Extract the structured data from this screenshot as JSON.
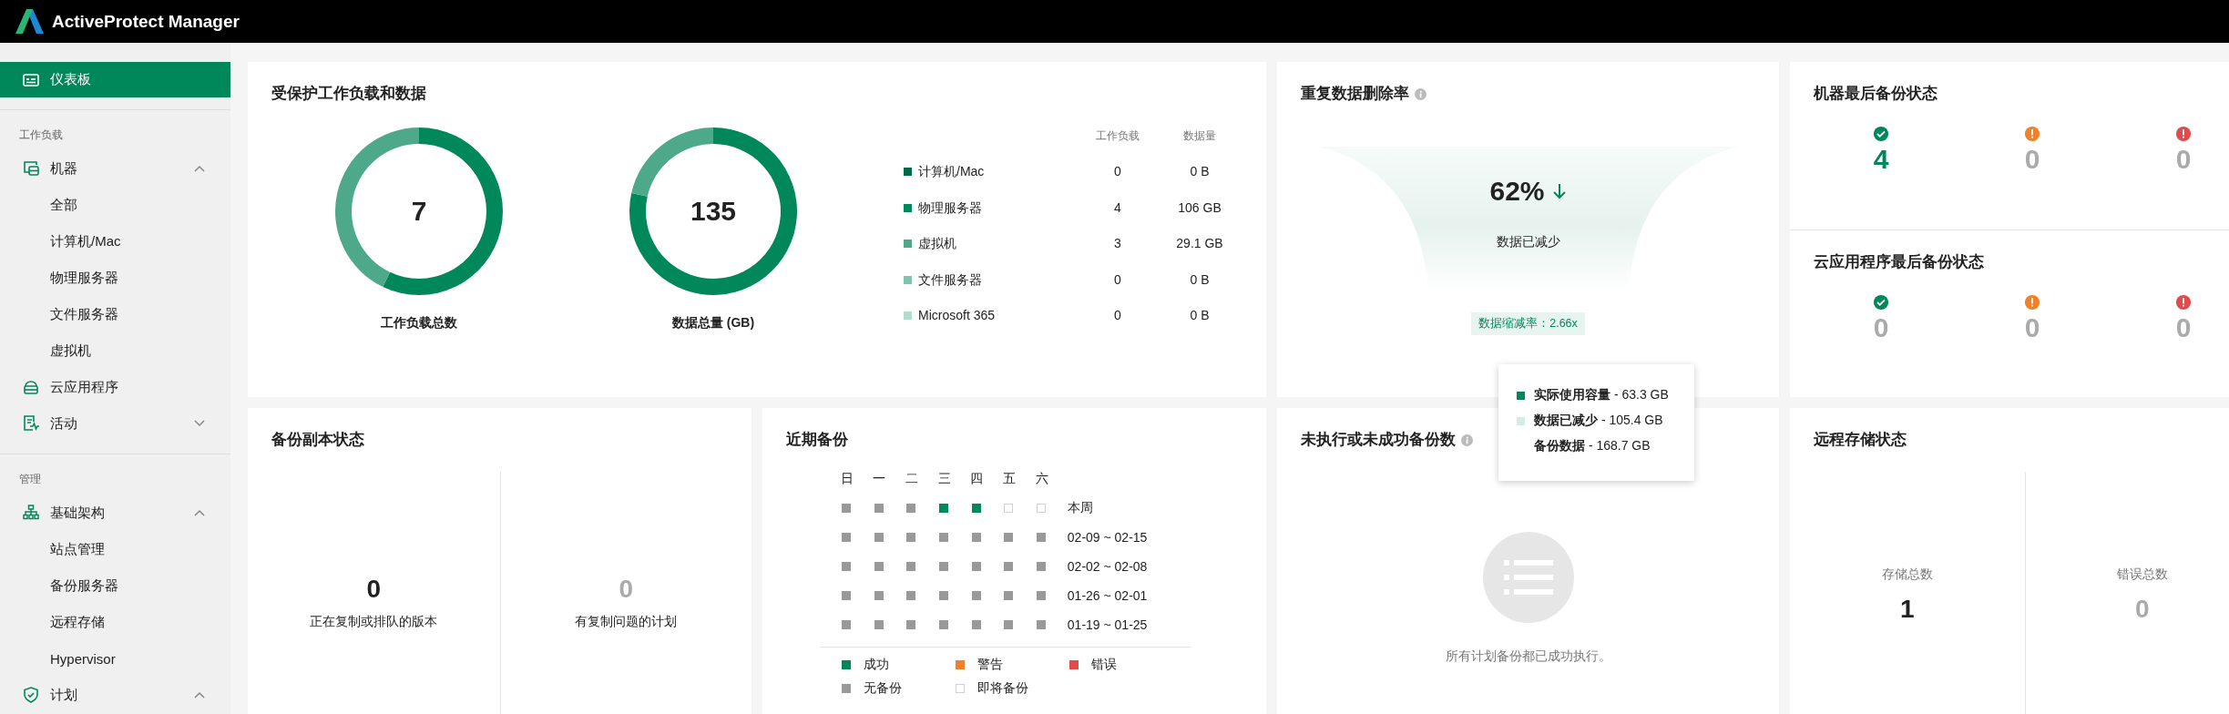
{
  "header": {
    "title": "ActiveProtect Manager"
  },
  "sidebar": {
    "top_item": {
      "label": "仪表板",
      "kind": "dashboard",
      "selected": true
    },
    "sections": [
      {
        "heading": "工作负载",
        "items": [
          {
            "label": "机器",
            "kind": "machine",
            "selected": false,
            "expanded": true,
            "children": [
              {
                "label": "全部",
                "selected": false
              },
              {
                "label": "计算机/Mac",
                "selected": false
              },
              {
                "label": "物理服务器",
                "selected": false
              },
              {
                "label": "文件服务器",
                "selected": false
              },
              {
                "label": "虚拟机",
                "selected": false
              }
            ]
          },
          {
            "label": "云应用程序",
            "kind": "cloud",
            "selected": false
          },
          {
            "label": "活动",
            "kind": "activity",
            "selected": false,
            "expanded": false
          }
        ]
      },
      {
        "heading": "管理",
        "items": [
          {
            "label": "基础架构",
            "kind": "network",
            "selected": false,
            "expanded": true,
            "children": [
              {
                "label": "站点管理",
                "selected": false
              },
              {
                "label": "备份服务器",
                "selected": false
              },
              {
                "label": "远程存储",
                "selected": false
              },
              {
                "label": "Hypervisor",
                "selected": false
              }
            ]
          },
          {
            "label": "计划",
            "kind": "shield",
            "selected": false,
            "expanded": true
          }
        ]
      }
    ]
  },
  "protected_workloads": {
    "title": "受保护工作负载和数据",
    "donuts": [
      {
        "value": "7",
        "caption": "工作负载总数",
        "chart_data": {
          "type": "donut",
          "values": [
            57.1,
            42.9
          ]
        }
      },
      {
        "value": "135",
        "caption": "数据总量 (GB)",
        "chart_data": {
          "type": "donut",
          "values": [
            78.5,
            21.5
          ]
        }
      }
    ],
    "legend": {
      "columns": [
        "工作负载",
        "数据量"
      ],
      "rows": [
        {
          "name": "计算机/Mac",
          "color": "#006b47",
          "workloads": "0",
          "data": "0 B"
        },
        {
          "name": "物理服务器",
          "color": "#00875a",
          "workloads": "4",
          "data": "106 GB"
        },
        {
          "name": "虚拟机",
          "color": "#4ea88a",
          "workloads": "3",
          "data": "29.1 GB"
        },
        {
          "name": "文件服务器",
          "color": "#80c4ac",
          "workloads": "0",
          "data": "0 B"
        },
        {
          "name": "Microsoft 365",
          "color": "#b3dccc",
          "workloads": "0",
          "data": "0 B"
        }
      ]
    }
  },
  "dedup": {
    "title": "重复数据删除率",
    "percent": "62%",
    "trend": {
      "kind": "down"
    },
    "caption": "数据已减少",
    "ratio_badge": "数据缩减率：2.66x"
  },
  "dedup_tooltip": {
    "rows": [
      {
        "text": "**实际使用容量** - 63.3 GB",
        "color": "#00875a"
      },
      {
        "text": "**数据已减少** - 105.4 GB",
        "color": "#d6ebe3"
      },
      {
        "text": "**备份数据** - 168.7 GB"
      }
    ]
  },
  "machine_backup_status": {
    "title": "机器最后备份状态",
    "items": [
      {
        "kind": "success",
        "count": "4",
        "highlighted": true
      },
      {
        "kind": "warning",
        "count": "0",
        "highlighted": false
      },
      {
        "kind": "error",
        "count": "0",
        "highlighted": false
      }
    ]
  },
  "cloud_backup_status": {
    "title": "云应用程序最后备份状态",
    "items": [
      {
        "kind": "success",
        "count": "0",
        "highlighted": false
      },
      {
        "kind": "warning",
        "count": "0",
        "highlighted": false
      },
      {
        "kind": "error",
        "count": "0",
        "highlighted": false
      }
    ]
  },
  "backup_copy_status": {
    "title": "备份副本状态",
    "stats": [
      {
        "value": "0",
        "label": "正在复制或排队的版本",
        "muted": false
      },
      {
        "value": "0",
        "label": "有复制问题的计划",
        "muted": true
      }
    ]
  },
  "recent_backups": {
    "title": "近期备份",
    "days": [
      "日",
      "一",
      "二",
      "三",
      "四",
      "五",
      "六"
    ],
    "weeks": [
      {
        "label": "本周",
        "cells": [
          {
            "kind": "none"
          },
          {
            "kind": "none"
          },
          {
            "kind": "none"
          },
          {
            "kind": "success"
          },
          {
            "kind": "success"
          },
          {
            "kind": "upcoming"
          },
          {
            "kind": "upcoming"
          }
        ]
      },
      {
        "label": "02-09 ~ 02-15",
        "cells": [
          {
            "kind": "none"
          },
          {
            "kind": "none"
          },
          {
            "kind": "none"
          },
          {
            "kind": "none"
          },
          {
            "kind": "none"
          },
          {
            "kind": "none"
          },
          {
            "kind": "none"
          }
        ]
      },
      {
        "label": "02-02 ~ 02-08",
        "cells": [
          {
            "kind": "none"
          },
          {
            "kind": "none"
          },
          {
            "kind": "none"
          },
          {
            "kind": "none"
          },
          {
            "kind": "none"
          },
          {
            "kind": "none"
          },
          {
            "kind": "none"
          }
        ]
      },
      {
        "label": "01-26 ~ 02-01",
        "cells": [
          {
            "kind": "none"
          },
          {
            "kind": "none"
          },
          {
            "kind": "none"
          },
          {
            "kind": "none"
          },
          {
            "kind": "none"
          },
          {
            "kind": "none"
          },
          {
            "kind": "none"
          }
        ]
      },
      {
        "label": "01-19 ~ 01-25",
        "cells": [
          {
            "kind": "none"
          },
          {
            "kind": "none"
          },
          {
            "kind": "none"
          },
          {
            "kind": "none"
          },
          {
            "kind": "none"
          },
          {
            "kind": "none"
          },
          {
            "kind": "none"
          }
        ]
      }
    ],
    "legend": [
      {
        "kind": "success",
        "label": "成功"
      },
      {
        "kind": "warning",
        "label": "警告"
      },
      {
        "kind": "error",
        "label": "错误"
      },
      {
        "kind": "none",
        "label": "无备份"
      },
      {
        "kind": "upcoming",
        "label": "即将备份"
      }
    ]
  },
  "failed_backups": {
    "title": "未执行或未成功备份数",
    "empty_message": "所有计划备份都已成功执行。"
  },
  "remote_storage": {
    "title": "远程存储状态",
    "stats": [
      {
        "label": "存储总数",
        "value": "1",
        "muted": false
      },
      {
        "label": "错误总数",
        "value": "0",
        "muted": true
      }
    ]
  }
}
